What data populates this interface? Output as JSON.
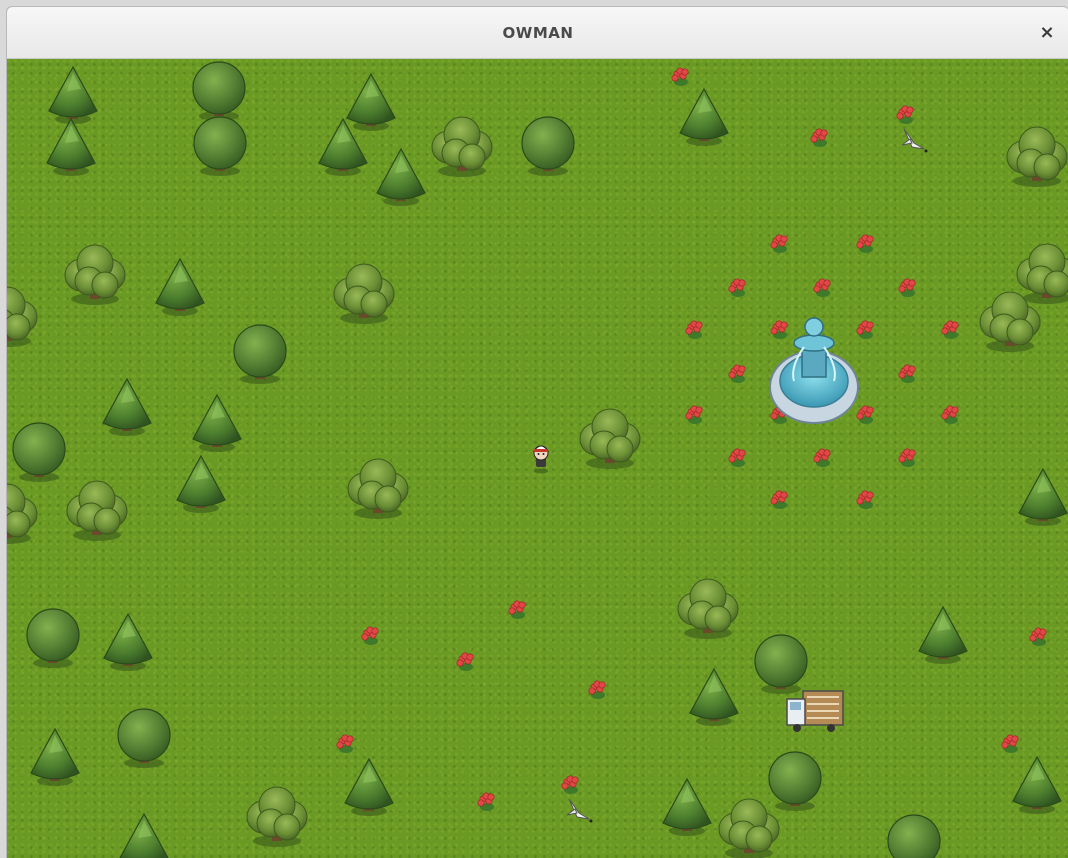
{
  "window": {
    "title": "OWMAN",
    "close_glyph": "×"
  },
  "sprites": {
    "player": "player-sprite",
    "fountain": "stone-fountain",
    "truck": "moving-truck",
    "bird": "white-bird",
    "flower": "red-flower",
    "tree_pine": "pine-tree",
    "tree_round": "round-tree",
    "tree_bushy": "bushy-tree"
  },
  "colors": {
    "grass": "#6b9a24",
    "tree_dark": "#3f6a2a",
    "tree_light": "#5f8f3a",
    "fountain_water": "#4fb3c9",
    "flower": "#e04848"
  }
}
